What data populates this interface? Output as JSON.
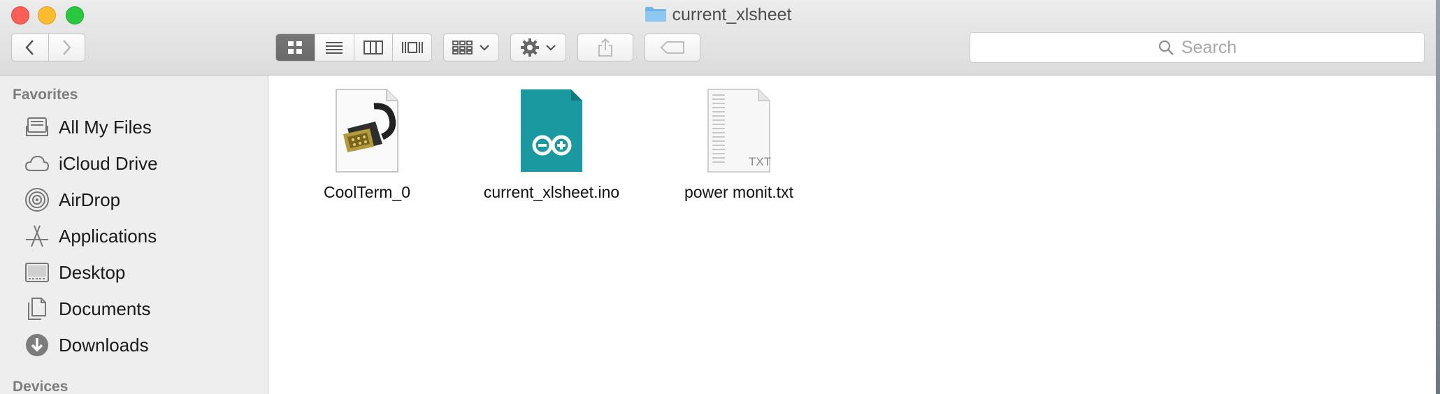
{
  "window": {
    "title": "current_xlsheet"
  },
  "toolbar": {
    "back_icon": "chevron-left-icon",
    "forward_icon": "chevron-right-icon",
    "view_modes": [
      "icon-view",
      "list-view",
      "column-view",
      "cover-flow-view"
    ],
    "active_view": "icon-view",
    "arrange_icon": "arrange-grid-icon",
    "action_icon": "gear-icon",
    "share_icon": "share-icon",
    "tags_icon": "tag-icon",
    "search_placeholder": "Search"
  },
  "sidebar": {
    "favorites_header": "Favorites",
    "items": [
      {
        "label": "All My Files",
        "icon": "all-files-icon"
      },
      {
        "label": "iCloud Drive",
        "icon": "cloud-icon"
      },
      {
        "label": "AirDrop",
        "icon": "airdrop-icon"
      },
      {
        "label": "Applications",
        "icon": "applications-icon"
      },
      {
        "label": "Desktop",
        "icon": "desktop-icon"
      },
      {
        "label": "Documents",
        "icon": "documents-icon"
      },
      {
        "label": "Downloads",
        "icon": "downloads-icon"
      }
    ],
    "devices_header": "Devices"
  },
  "files": [
    {
      "name": "CoolTerm_0",
      "icon": "serial-connector-icon"
    },
    {
      "name": "current_xlsheet.ino",
      "icon": "arduino-icon"
    },
    {
      "name": "power monit.txt",
      "icon": "text-file-icon",
      "badge": "TXT"
    }
  ],
  "colors": {
    "close": "#fc5f57",
    "minimize": "#fdbc2e",
    "maximize": "#29c840",
    "arduino_teal": "#1a9aa0",
    "folder_blue": "#6cb4ea"
  }
}
